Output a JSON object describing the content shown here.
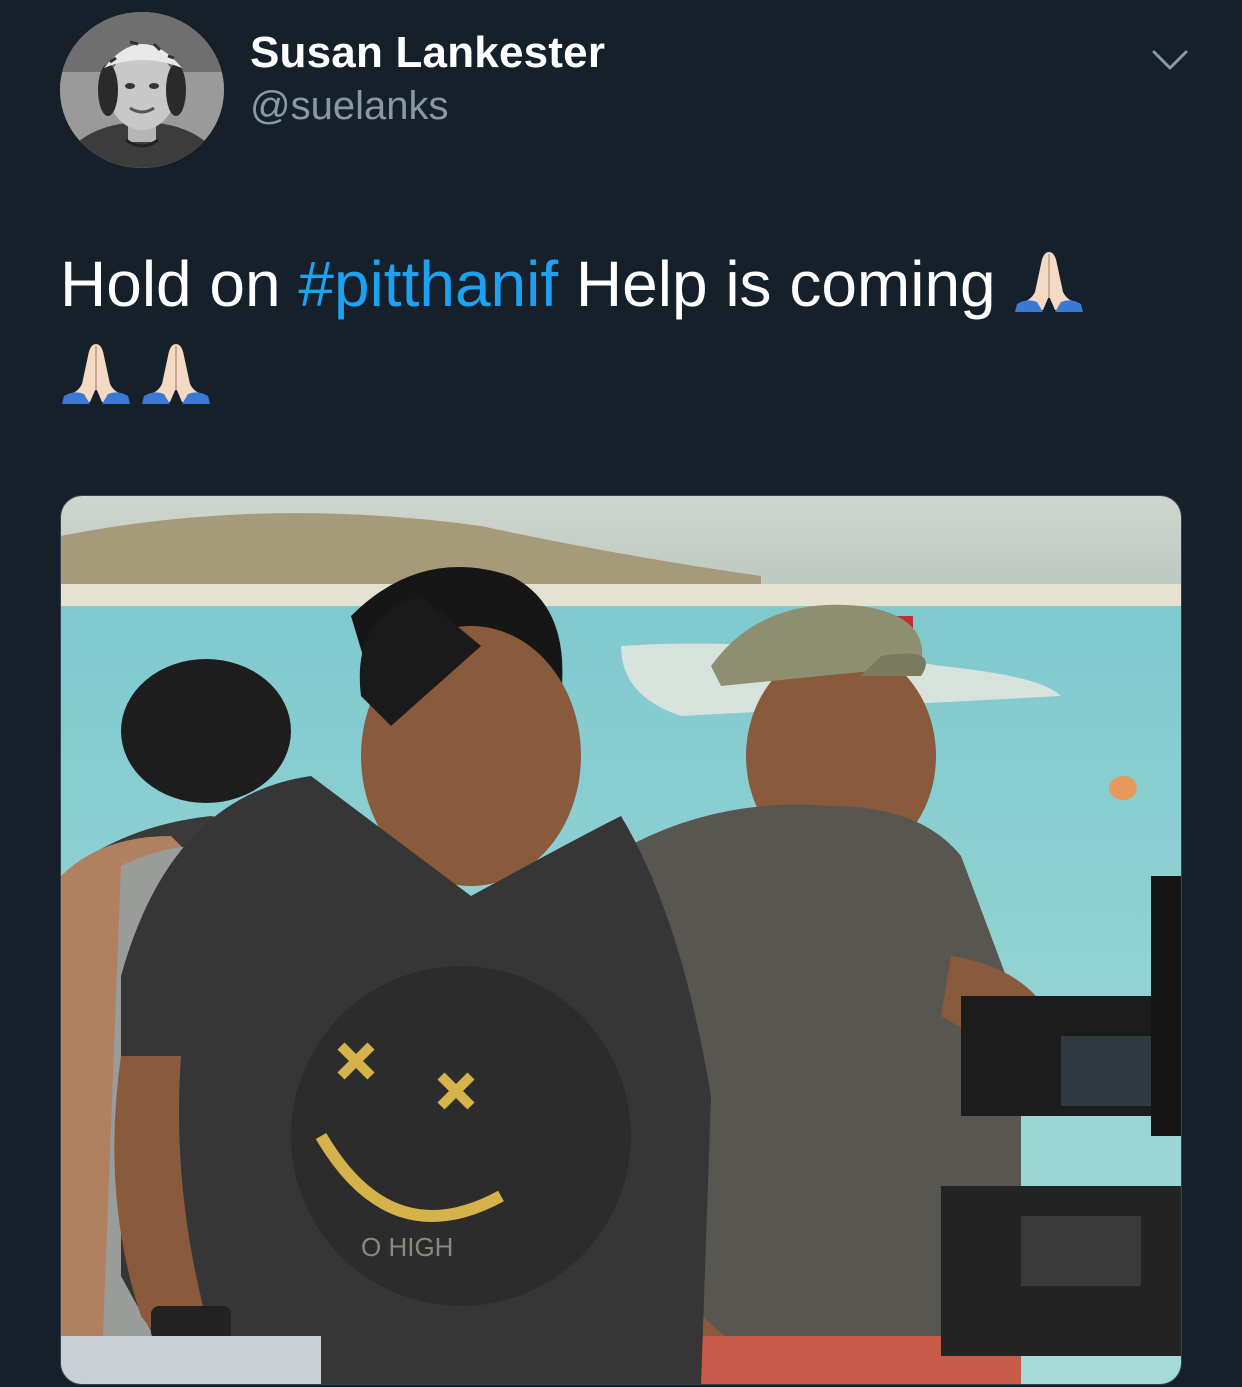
{
  "tweet": {
    "author": {
      "display_name": "Susan Lankester",
      "handle": "@suelanks",
      "avatar_icon": "profile-photo"
    },
    "text": {
      "prefix": "Hold on ",
      "hashtag": "#pitthanif",
      "suffix": " Help is coming",
      "emoji_icon": "folded-hands-emoji",
      "emoji_count": 3
    },
    "menu_icon": "chevron-down-icon",
    "media": {
      "type": "photo",
      "shirt_text": "O HIGH"
    }
  },
  "colors": {
    "background": "#15202b",
    "text": "#ffffff",
    "secondary_text": "#8899a6",
    "link": "#1da1f2"
  }
}
